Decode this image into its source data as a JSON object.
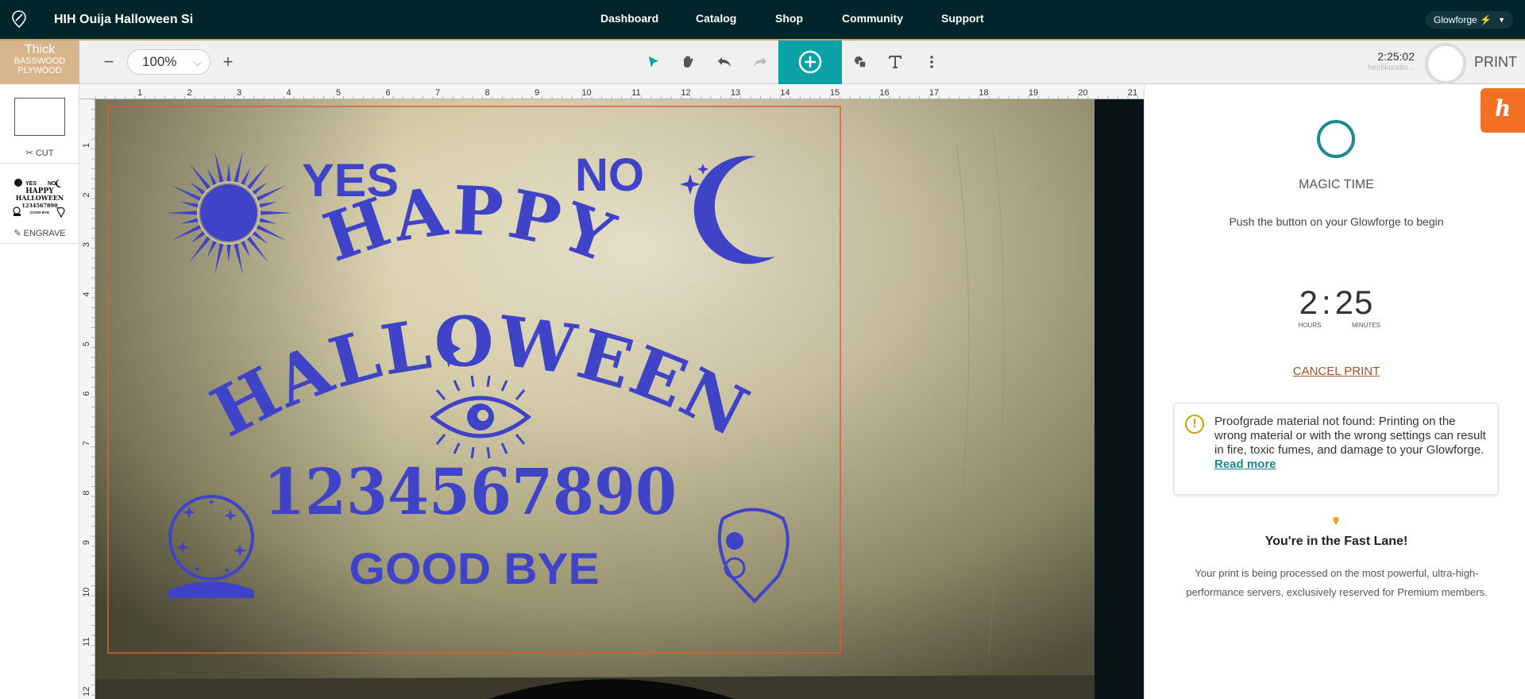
{
  "nav": {
    "project_title": "HIH Ouija Halloween Sig",
    "links": [
      "Dashboard",
      "Catalog",
      "Shop",
      "Community",
      "Support"
    ],
    "account": "Glowforge",
    "account_icon": "bolt-icon"
  },
  "toolbar": {
    "material_line1": "Thick",
    "material_line2": "BASSWOOD",
    "material_line3": "PLYWOOD",
    "material_badge": "?",
    "zoom_out": "−",
    "zoom_value": "100%",
    "zoom_in": "+",
    "clock": "2:25:02",
    "user": "heidikundin...",
    "print": "PRINT"
  },
  "steps": {
    "cut_label": "CUT",
    "engrave_label": "ENGRAVE"
  },
  "ruler": {
    "h": [
      "1",
      "2",
      "3",
      "4",
      "5",
      "6",
      "7",
      "8",
      "9",
      "10",
      "11",
      "12",
      "13",
      "14",
      "15",
      "16",
      "17",
      "18",
      "19",
      "20",
      "21"
    ],
    "v": [
      "1",
      "2",
      "3",
      "4",
      "5",
      "6",
      "7",
      "8",
      "9",
      "10",
      "11",
      "12"
    ]
  },
  "design": {
    "yes": "YES",
    "no": "NO",
    "happy": "HAPPY",
    "halloween": "HALLOWEEN",
    "numbers": "1234567890",
    "goodbye": "GOOD BYE",
    "color": "#3f43c8",
    "cut_outline_color": "#e05a3a"
  },
  "thumb": {
    "yes": "YES",
    "no": "NO",
    "happy": "HAPPY",
    "halloween": "HALLOWEEN",
    "numbers": "1234567890",
    "goodbye": "GOOD BYE"
  },
  "side": {
    "helper_badge": "h",
    "magic_title": "MAGIC TIME",
    "magic_sub": "Push the button on your Glowforge to begin",
    "timer_hours": "2",
    "timer_minutes": "25",
    "label_hours": "HOURS",
    "label_minutes": "MINUTES",
    "cancel": "CANCEL PRINT",
    "warning_icon": "!",
    "warning_text": "Proofgrade material not found: Printing on the wrong material or with the wrong settings can result in fire, toxic fumes, and damage to your Glowforge.",
    "warning_link": "Read more",
    "fast_title": "You're in the Fast Lane!",
    "fast_text": "Your print is being processed on the most powerful, ultra-high-performance servers, exclusively reserved for Premium members."
  },
  "colors": {
    "accent": "#0aa1a7",
    "nav_bg": "#00252a",
    "cancel": "#a0522d",
    "warning": "#c9a200",
    "helper": "#f37022"
  }
}
